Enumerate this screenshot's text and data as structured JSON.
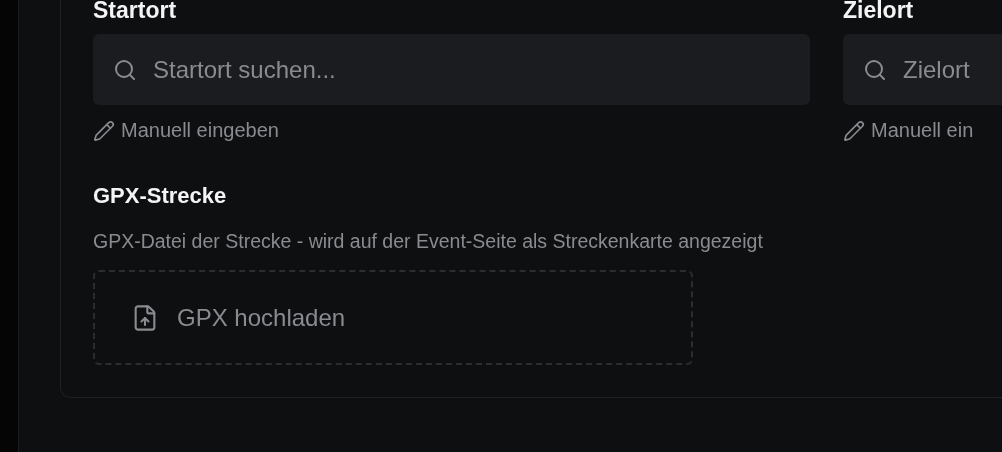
{
  "locations": [
    {
      "label": "Startort",
      "placeholder": "Startort suchen...",
      "manual_link": "Manuell eingeben"
    },
    {
      "label": "Zielort",
      "placeholder": "Zielort",
      "manual_link": "Manuell ein"
    }
  ],
  "gpx": {
    "title": "GPX-Strecke",
    "description": "GPX-Datei der Strecke - wird auf der Event-Seite als Streckenkarte angezeigt",
    "upload_button": "GPX hochladen"
  }
}
